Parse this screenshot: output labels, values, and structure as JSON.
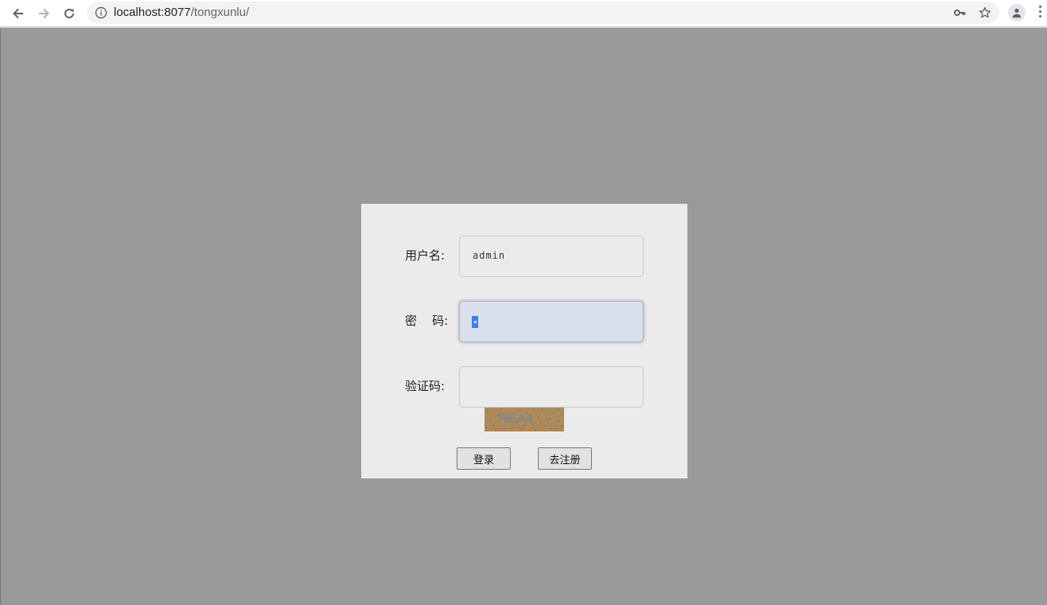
{
  "browser": {
    "url_host": "localhost:8077",
    "url_path": "/tongxunlu/",
    "icons": {
      "back": "back-arrow-icon",
      "forward": "forward-arrow-icon",
      "reload": "reload-icon",
      "info": "info-icon",
      "key": "key-icon",
      "star": "star-icon",
      "profile": "profile-icon",
      "menu": "menu-dots-icon"
    }
  },
  "login": {
    "username_label": "用户名:",
    "username_value": "admin",
    "password_label": "密    码:",
    "password_value": "•",
    "captcha_label": "验证码:",
    "captcha_value": "",
    "captcha_code": "REA4",
    "login_button": "登录",
    "register_button": "去注册"
  },
  "colors": {
    "page_background": "#999999",
    "card_background": "#ebebeb",
    "focused_input": "#d9dfeb",
    "selection": "#3b82f0"
  }
}
